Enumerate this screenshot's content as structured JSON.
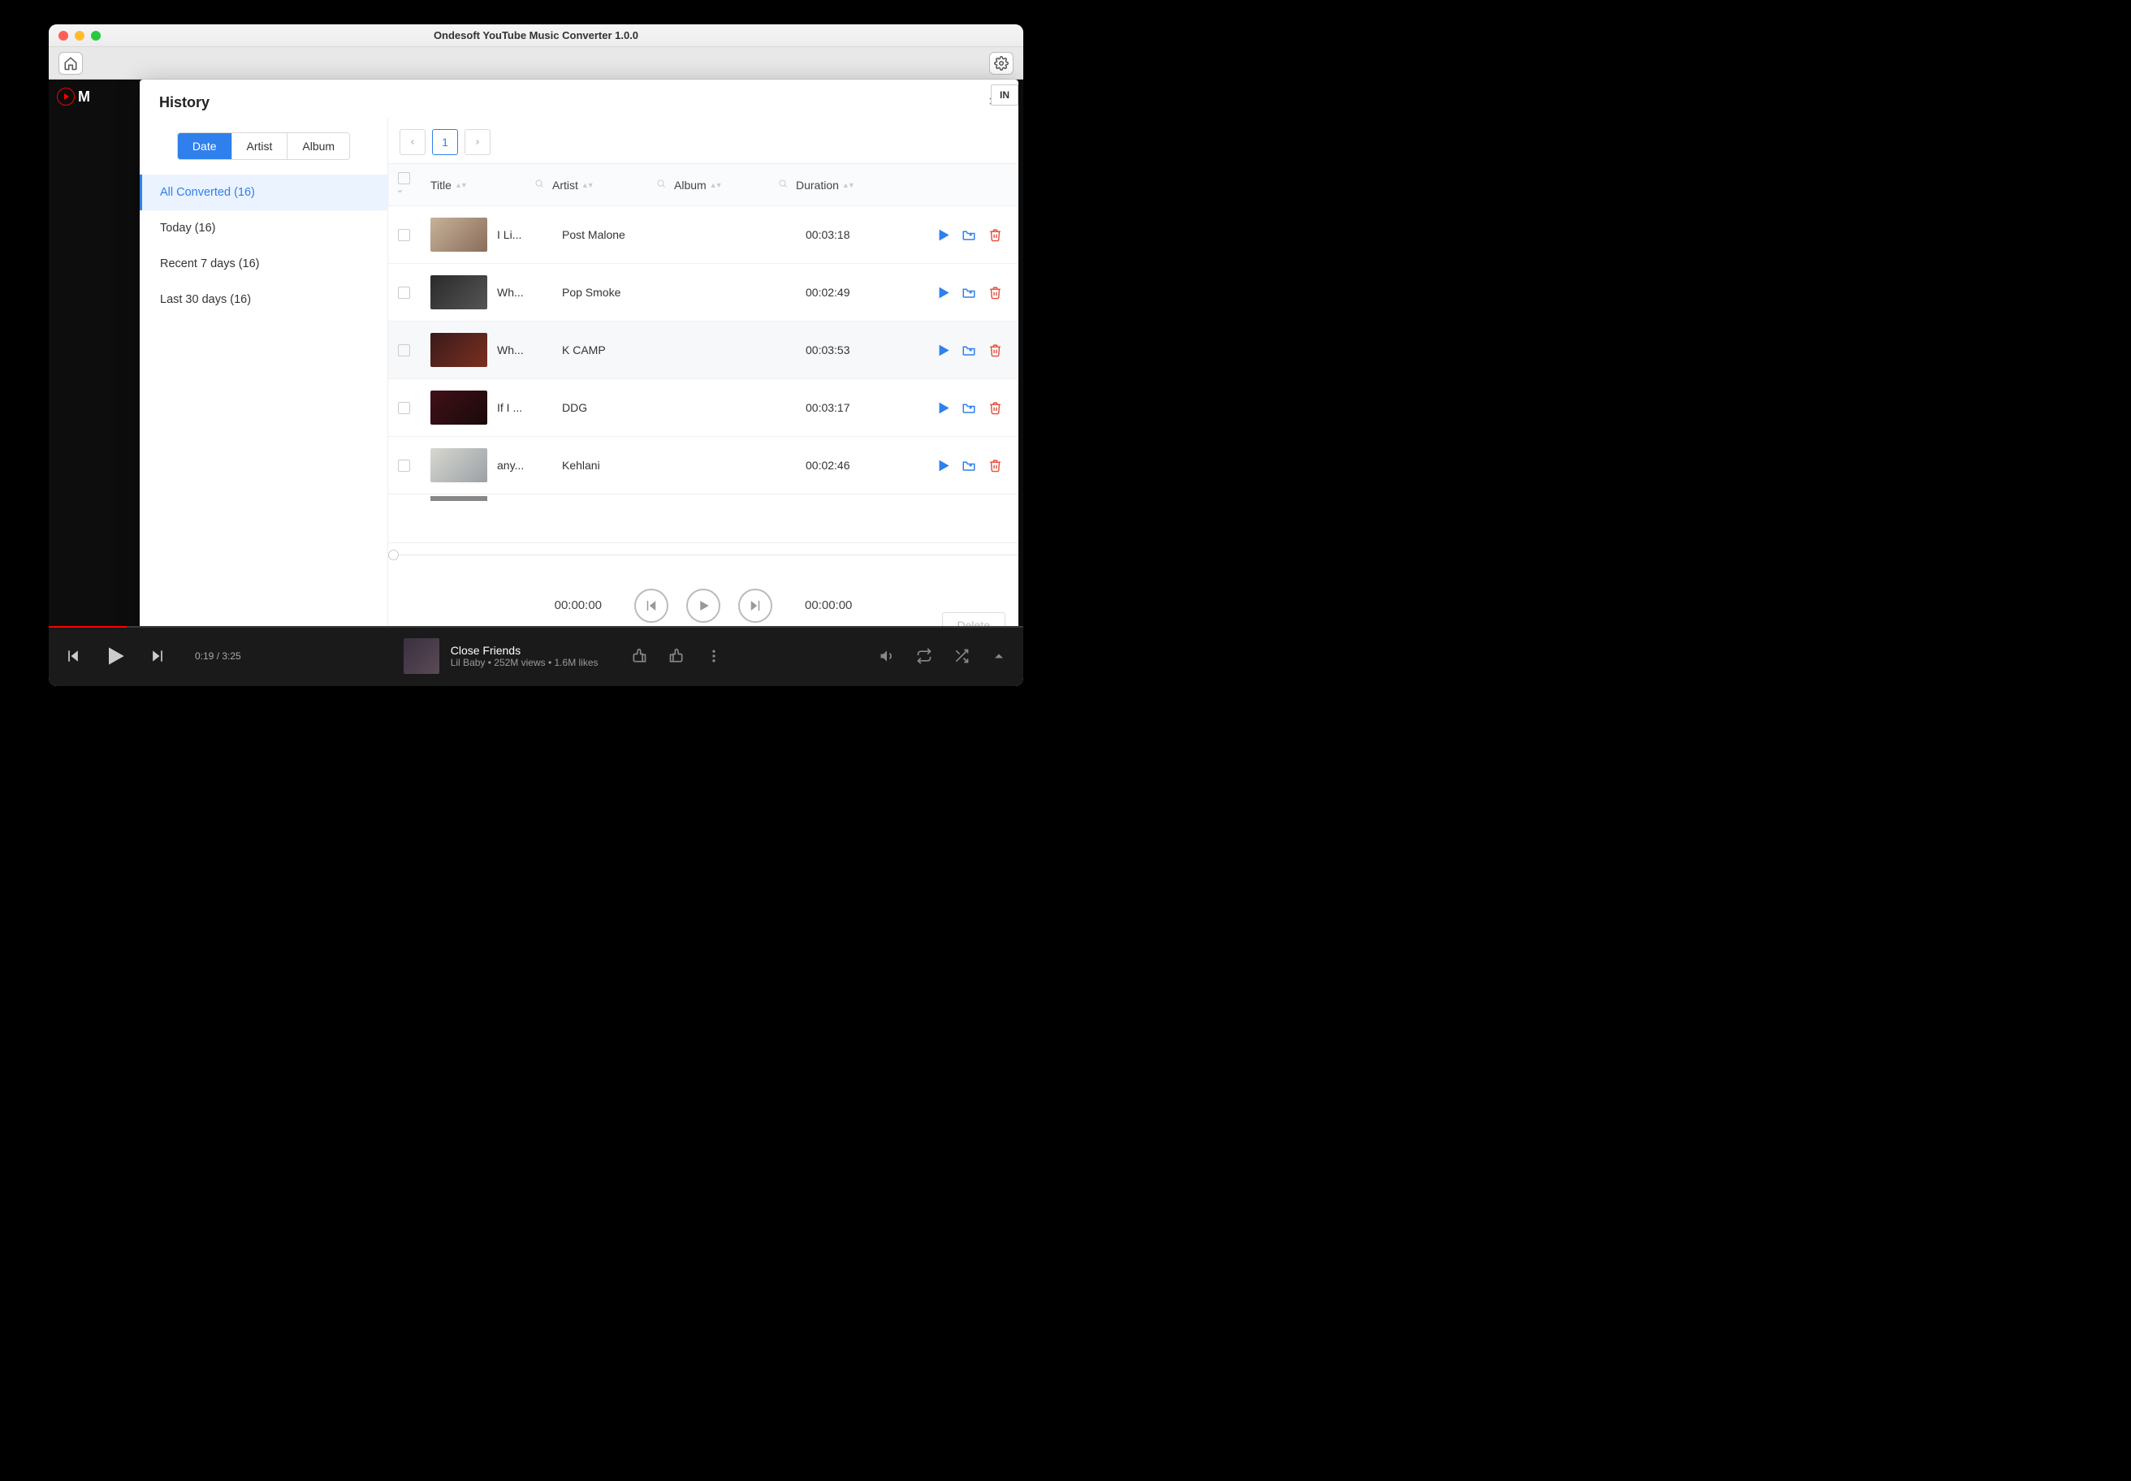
{
  "window": {
    "title": "Ondesoft YouTube Music Converter 1.0.0"
  },
  "toolbar": {
    "signin": "IN"
  },
  "ytlogo": "M",
  "modal": {
    "title": "History",
    "segments": {
      "date": "Date",
      "artist": "Artist",
      "album": "Album"
    },
    "sidebar": {
      "all": "All Converted (16)",
      "today": "Today (16)",
      "recent7": "Recent 7 days (16)",
      "last30": "Last 30 days (16)"
    },
    "pager": {
      "current": "1"
    },
    "headers": {
      "title": "Title",
      "artist": "Artist",
      "album": "Album",
      "duration": "Duration"
    },
    "rows": [
      {
        "title": "I Li...",
        "artist": "Post Malone",
        "album": "",
        "duration": "00:03:18"
      },
      {
        "title": "Wh...",
        "artist": "Pop Smoke",
        "album": "",
        "duration": "00:02:49"
      },
      {
        "title": "Wh...",
        "artist": "K CAMP",
        "album": "",
        "duration": "00:03:53"
      },
      {
        "title": "If I ...",
        "artist": "DDG",
        "album": "",
        "duration": "00:03:17"
      },
      {
        "title": "any...",
        "artist": "Kehlani",
        "album": "",
        "duration": "00:02:46"
      }
    ],
    "player": {
      "elapsed": "00:00:00",
      "total": "00:00:00"
    },
    "delete": "Delete"
  },
  "ytplayer": {
    "time": "0:19 / 3:25",
    "title": "Close Friends",
    "sub": "Lil Baby • 252M views • 1.6M likes"
  }
}
